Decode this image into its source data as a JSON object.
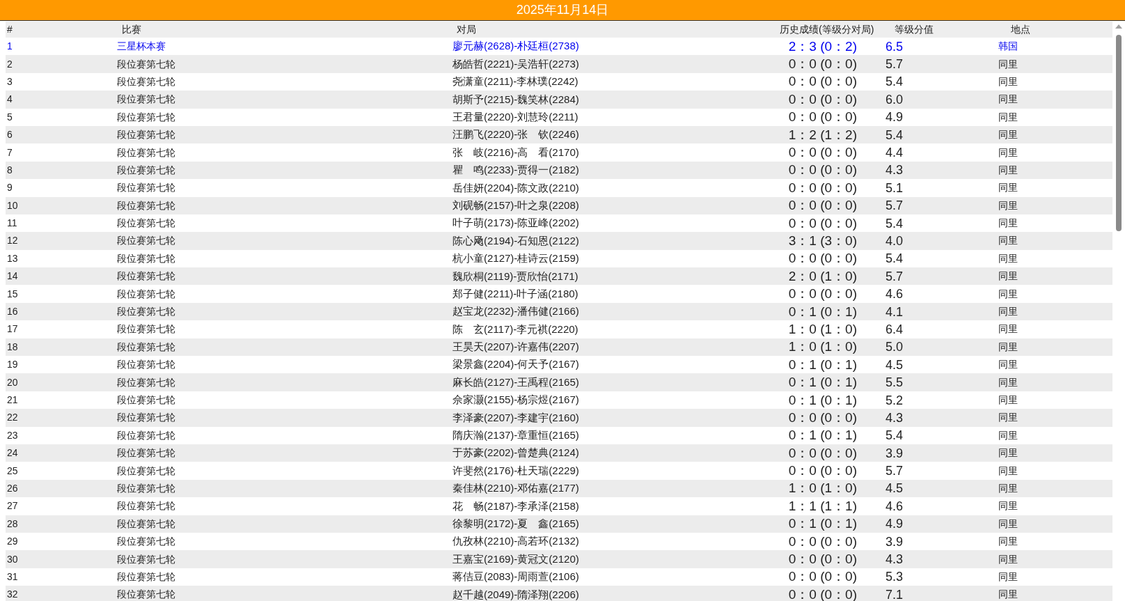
{
  "title": "2025年11月14日",
  "columns": [
    "#",
    "比赛",
    "对局",
    "历史成绩(等级分对局)",
    "等级分值",
    "地点"
  ],
  "rows": [
    {
      "no": "1",
      "event": "三星杯本赛",
      "match": "廖元赫(2628)-朴廷桓(2738)",
      "record": "2：3 (0：2)",
      "rating": "6.5",
      "place": "韩国",
      "kind": "link"
    },
    {
      "no": "2",
      "event": "段位赛第七轮",
      "match": "杨皓哲(2221)-吴浩轩(2273)",
      "record": "0：0 (0：0)",
      "rating": "5.7",
      "place": "同里",
      "kind": "normal"
    },
    {
      "no": "3",
      "event": "段位赛第七轮",
      "match": "尧潇童(2211)-李林璞(2242)",
      "record": "0：0 (0：0)",
      "rating": "5.4",
      "place": "同里",
      "kind": "normal"
    },
    {
      "no": "4",
      "event": "段位赛第七轮",
      "match": "胡斯予(2215)-魏笑林(2284)",
      "record": "0：0 (0：0)",
      "rating": "6.0",
      "place": "同里",
      "kind": "normal"
    },
    {
      "no": "5",
      "event": "段位赛第七轮",
      "match": "王君量(2220)-刘慧玲(2211)",
      "record": "0：0 (0：0)",
      "rating": "4.9",
      "place": "同里",
      "kind": "normal"
    },
    {
      "no": "6",
      "event": "段位赛第七轮",
      "match": "汪鹏飞(2220)-张　钦(2246)",
      "record": "1：2 (1：2)",
      "rating": "5.4",
      "place": "同里",
      "kind": "normal"
    },
    {
      "no": "7",
      "event": "段位赛第七轮",
      "match": "张　岐(2216)-高　看(2170)",
      "record": "0：0 (0：0)",
      "rating": "4.4",
      "place": "同里",
      "kind": "normal"
    },
    {
      "no": "8",
      "event": "段位赛第七轮",
      "match": "瞿　鸣(2233)-贾得一(2182)",
      "record": "0：0 (0：0)",
      "rating": "4.3",
      "place": "同里",
      "kind": "normal"
    },
    {
      "no": "9",
      "event": "段位赛第七轮",
      "match": "岳佳妍(2204)-陈文政(2210)",
      "record": "0：0 (0：0)",
      "rating": "5.1",
      "place": "同里",
      "kind": "normal"
    },
    {
      "no": "10",
      "event": "段位赛第七轮",
      "match": "刘砚畅(2157)-叶之泉(2208)",
      "record": "0：0 (0：0)",
      "rating": "5.7",
      "place": "同里",
      "kind": "normal"
    },
    {
      "no": "11",
      "event": "段位赛第七轮",
      "match": "叶子萌(2173)-陈亚峰(2202)",
      "record": "0：0 (0：0)",
      "rating": "5.4",
      "place": "同里",
      "kind": "normal"
    },
    {
      "no": "12",
      "event": "段位赛第七轮",
      "match": "陈心飏(2194)-石知恩(2122)",
      "record": "3：1 (3：0)",
      "rating": "4.0",
      "place": "同里",
      "kind": "normal"
    },
    {
      "no": "13",
      "event": "段位赛第七轮",
      "match": "杭小童(2127)-桂诗云(2159)",
      "record": "0：0 (0：0)",
      "rating": "5.4",
      "place": "同里",
      "kind": "normal"
    },
    {
      "no": "14",
      "event": "段位赛第七轮",
      "match": "魏欣桐(2119)-贾欣怡(2171)",
      "record": "2：0 (1：0)",
      "rating": "5.7",
      "place": "同里",
      "kind": "normal"
    },
    {
      "no": "15",
      "event": "段位赛第七轮",
      "match": "郑子健(2211)-叶子涵(2180)",
      "record": "0：0 (0：0)",
      "rating": "4.6",
      "place": "同里",
      "kind": "normal"
    },
    {
      "no": "16",
      "event": "段位赛第七轮",
      "match": "赵宝龙(2232)-潘伟健(2166)",
      "record": "0：1 (0：1)",
      "rating": "4.1",
      "place": "同里",
      "kind": "normal"
    },
    {
      "no": "17",
      "event": "段位赛第七轮",
      "match": "陈　玄(2117)-李元祺(2220)",
      "record": "1：0 (1：0)",
      "rating": "6.4",
      "place": "同里",
      "kind": "normal"
    },
    {
      "no": "18",
      "event": "段位赛第七轮",
      "match": "王昊天(2207)-许嘉伟(2207)",
      "record": "1：0 (1：0)",
      "rating": "5.0",
      "place": "同里",
      "kind": "normal"
    },
    {
      "no": "19",
      "event": "段位赛第七轮",
      "match": "梁景鑫(2204)-何天予(2167)",
      "record": "0：1 (0：1)",
      "rating": "4.5",
      "place": "同里",
      "kind": "normal"
    },
    {
      "no": "20",
      "event": "段位赛第七轮",
      "match": "麻长皓(2127)-王禹程(2165)",
      "record": "0：1 (0：1)",
      "rating": "5.5",
      "place": "同里",
      "kind": "normal"
    },
    {
      "no": "21",
      "event": "段位赛第七轮",
      "match": "佘家灏(2155)-杨宗煜(2167)",
      "record": "0：1 (0：1)",
      "rating": "5.2",
      "place": "同里",
      "kind": "normal"
    },
    {
      "no": "22",
      "event": "段位赛第七轮",
      "match": "李泽豪(2207)-李建宇(2160)",
      "record": "0：0 (0：0)",
      "rating": "4.3",
      "place": "同里",
      "kind": "normal"
    },
    {
      "no": "23",
      "event": "段位赛第七轮",
      "match": "隋庆瀚(2137)-章重恒(2165)",
      "record": "0：1 (0：1)",
      "rating": "5.4",
      "place": "同里",
      "kind": "normal"
    },
    {
      "no": "24",
      "event": "段位赛第七轮",
      "match": "于苏豪(2202)-曾楚典(2124)",
      "record": "0：0 (0：0)",
      "rating": "3.9",
      "place": "同里",
      "kind": "normal"
    },
    {
      "no": "25",
      "event": "段位赛第七轮",
      "match": "许斐然(2176)-杜天瑞(2229)",
      "record": "0：0 (0：0)",
      "rating": "5.7",
      "place": "同里",
      "kind": "normal"
    },
    {
      "no": "26",
      "event": "段位赛第七轮",
      "match": "秦佳林(2210)-邓佑嘉(2177)",
      "record": "1：0 (1：0)",
      "rating": "4.5",
      "place": "同里",
      "kind": "normal"
    },
    {
      "no": "27",
      "event": "段位赛第七轮",
      "match": "花　畅(2187)-李承泽(2158)",
      "record": "1：1 (1：1)",
      "rating": "4.6",
      "place": "同里",
      "kind": "normal"
    },
    {
      "no": "28",
      "event": "段位赛第七轮",
      "match": "徐黎明(2172)-夏　鑫(2165)",
      "record": "0：1 (0：1)",
      "rating": "4.9",
      "place": "同里",
      "kind": "normal"
    },
    {
      "no": "29",
      "event": "段位赛第七轮",
      "match": "仇孜林(2210)-高若环(2132)",
      "record": "0：0 (0：0)",
      "rating": "3.9",
      "place": "同里",
      "kind": "normal"
    },
    {
      "no": "30",
      "event": "段位赛第七轮",
      "match": "王嘉宝(2169)-黄冠文(2120)",
      "record": "0：0 (0：0)",
      "rating": "4.3",
      "place": "同里",
      "kind": "normal"
    },
    {
      "no": "31",
      "event": "段位赛第七轮",
      "match": "蒋佶豆(2083)-周雨萱(2106)",
      "record": "0：0 (0：0)",
      "rating": "5.3",
      "place": "同里",
      "kind": "normal"
    },
    {
      "no": "32",
      "event": "段位赛第七轮",
      "match": "赵千越(2049)-隋泽翔(2206)",
      "record": "0：0 (0：0)",
      "rating": "7.1",
      "place": "同里",
      "kind": "normal"
    }
  ]
}
